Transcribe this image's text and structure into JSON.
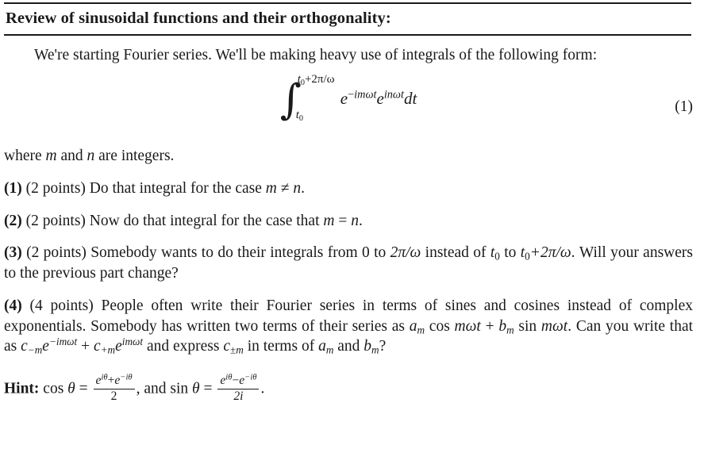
{
  "document": {
    "title": "Review of sinusoidal functions and their orthogonality:",
    "intro": "We're starting Fourier series. We'll be making heavy use of integrals of the following form:",
    "equation": {
      "number": "(1)",
      "integral_sign": "∫",
      "upper_limit_base": "t",
      "upper_limit_base_sub": "0",
      "upper_limit_rest": "+2π/ω",
      "lower_limit_base": "t",
      "lower_limit_sub": "0",
      "integrand_e1": "e",
      "integrand_e1_exp_minus": "−",
      "integrand_e1_exp": "imωt",
      "integrand_e2": "e",
      "integrand_e2_exp": "inωt",
      "differential": "dt",
      "plain_text": "∫ from t₀ to t₀+2π/ω of e^(-imωt) e^(inωt) dt"
    },
    "where_clause": {
      "prefix": "where ",
      "var_m": "m",
      "middle": " and ",
      "var_n": "n",
      "suffix": " are integers."
    },
    "problems": [
      {
        "number": "(1)",
        "points": "(2 points)",
        "text_before": " Do that integral for the case ",
        "math_m": "m",
        "math_rel": "≠",
        "math_n": "n",
        "text_after": "."
      },
      {
        "number": "(2)",
        "points": "(2 points)",
        "text_before": " Now do that integral for the case that ",
        "math_m": "m",
        "math_rel": "=",
        "math_n": "n",
        "text_after": "."
      },
      {
        "number": "(3)",
        "points": "(2 points)",
        "seg1": " Somebody wants to do their integrals from 0 to ",
        "seg_math1": "2π/ω",
        "seg2": " instead of ",
        "seg_math2_base": "t",
        "seg_math2_sub": "0",
        "seg3": " to ",
        "seg_math3_base": "t",
        "seg_math3_sub": "0",
        "seg_math3_rest": "+2π/ω",
        "seg4": ". Will your answers to the previous part change?"
      },
      {
        "number": "(4)",
        "points": "(4 points)",
        "seg1": " People often write their Fourier series in terms of sines and cosines instead of complex exponentials. Somebody has written two terms of their series as ",
        "term_a": "a",
        "term_a_sub": "m",
        "cos_op": "cos",
        "cos_arg": "mωt",
        "plus1": " + ",
        "term_b": "b",
        "term_b_sub": "m",
        "sin_op": "sin",
        "sin_arg": "mωt",
        "seg2": ". Can you write that as ",
        "c_minus": "c",
        "c_minus_sub": "−m",
        "e1": "e",
        "e1_exp": "−imωt",
        "plus2": " + ",
        "c_plus": "c",
        "c_plus_sub": "+m",
        "e2": "e",
        "e2_exp": "imωt",
        "seg3": " and express ",
        "c_pm": "c",
        "c_pm_sub": "±m",
        "seg4": " in terms of ",
        "final_a": "a",
        "final_a_sub": "m",
        "seg5": " and ",
        "final_b": "b",
        "final_b_sub": "m",
        "seg6": "?"
      }
    ],
    "hint": {
      "label": "Hint:",
      "cos_op": "cos",
      "theta1": "θ",
      "eq1": " = ",
      "cos_num_e1": "e",
      "cos_num_e1_exp": "iθ",
      "cos_num_plus": "+",
      "cos_num_e2": "e",
      "cos_num_e2_exp": "−iθ",
      "cos_den": "2",
      "middle": ", and ",
      "sin_op": "sin",
      "theta2": "θ",
      "eq2": " = ",
      "sin_num_e1": "e",
      "sin_num_e1_exp": "iθ",
      "sin_num_minus": "−",
      "sin_num_e2": "e",
      "sin_num_e2_exp": "−iθ",
      "sin_den": "2i",
      "period": "."
    }
  },
  "style": {
    "text_color": "#1a1a1a",
    "background": "#ffffff"
  }
}
